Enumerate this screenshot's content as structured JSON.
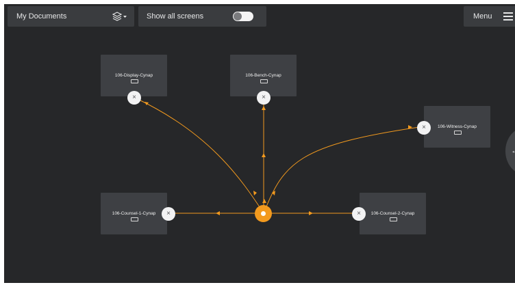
{
  "toolbar": {
    "documents_label": "My Documents",
    "show_all_screens_label": "Show all screens",
    "show_all_screens_on": false,
    "menu_label": "Menu"
  },
  "screens": [
    {
      "name": "106-Display-Cynap"
    },
    {
      "name": "106-Bench-Cynap"
    },
    {
      "name": "106-Witness-Cynap"
    },
    {
      "name": "106-Counsel-1-Cynap"
    },
    {
      "name": "106-Counsel-2-Cynap"
    }
  ],
  "remove_glyph": "×",
  "side_panel_glyph": "←",
  "colors": {
    "background": "#262729",
    "tile": "#3e4044",
    "link": "#f39a1e",
    "source": "#f39a1e"
  }
}
